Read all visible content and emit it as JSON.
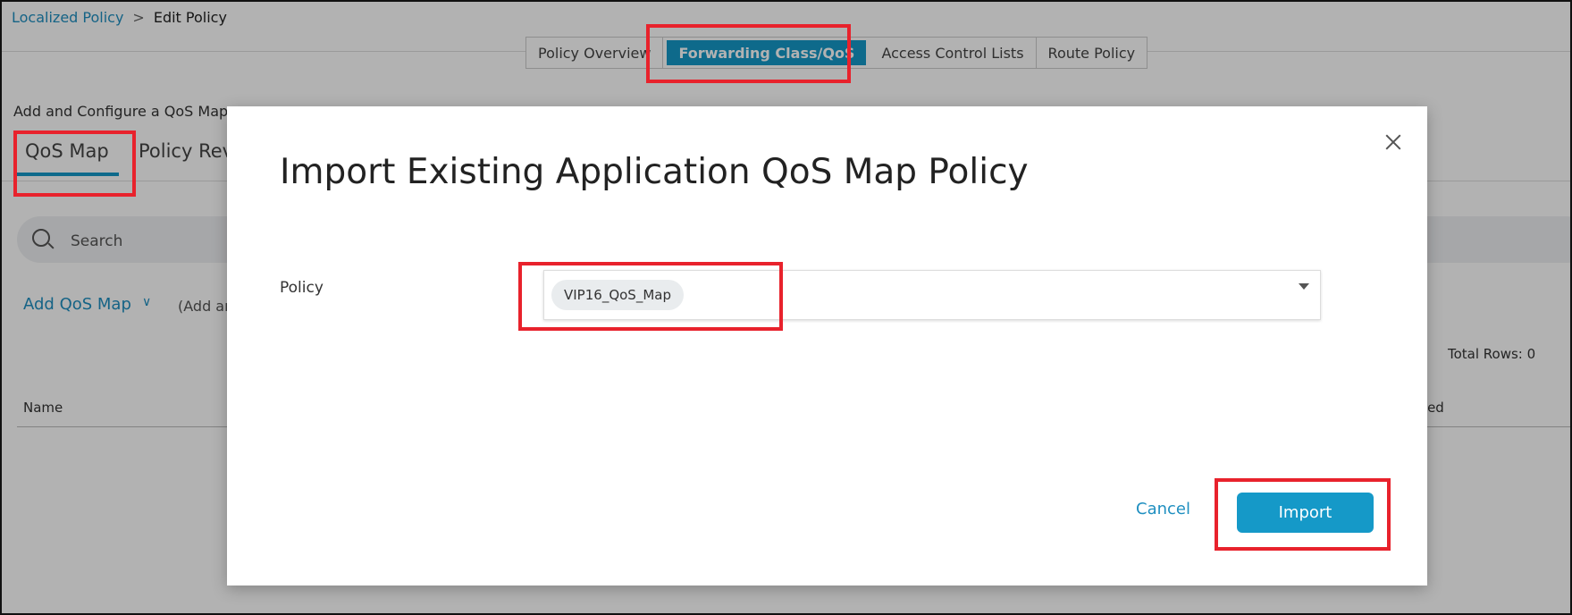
{
  "breadcrumb": {
    "parent": "Localized Policy",
    "separator": ">",
    "current": "Edit Policy"
  },
  "tabs": [
    {
      "label": "Policy Overview",
      "active": false
    },
    {
      "label": "Forwarding Class/QoS",
      "active": true
    },
    {
      "label": "Access Control Lists",
      "active": false
    },
    {
      "label": "Route Policy",
      "active": false
    }
  ],
  "section": {
    "title": "Add and Configure a QoS Map",
    "subtabs": [
      "QoS Map",
      "Policy Rev"
    ]
  },
  "search": {
    "label": "Search"
  },
  "list": {
    "add_label": "Add QoS Map",
    "add_chevron": "∨",
    "add_hint": "(Add ar",
    "total_rows": "Total Rows: 0",
    "col_name": "Name",
    "col_right": "ated"
  },
  "modal": {
    "title": "Import Existing Application QoS Map Policy",
    "field_label": "Policy",
    "selected_policy": "VIP16_QoS_Map",
    "cancel_label": "Cancel",
    "import_label": "Import"
  },
  "colors": {
    "accent": "#1599c8",
    "link": "#1f8fc0",
    "highlight": "#e8222c"
  }
}
